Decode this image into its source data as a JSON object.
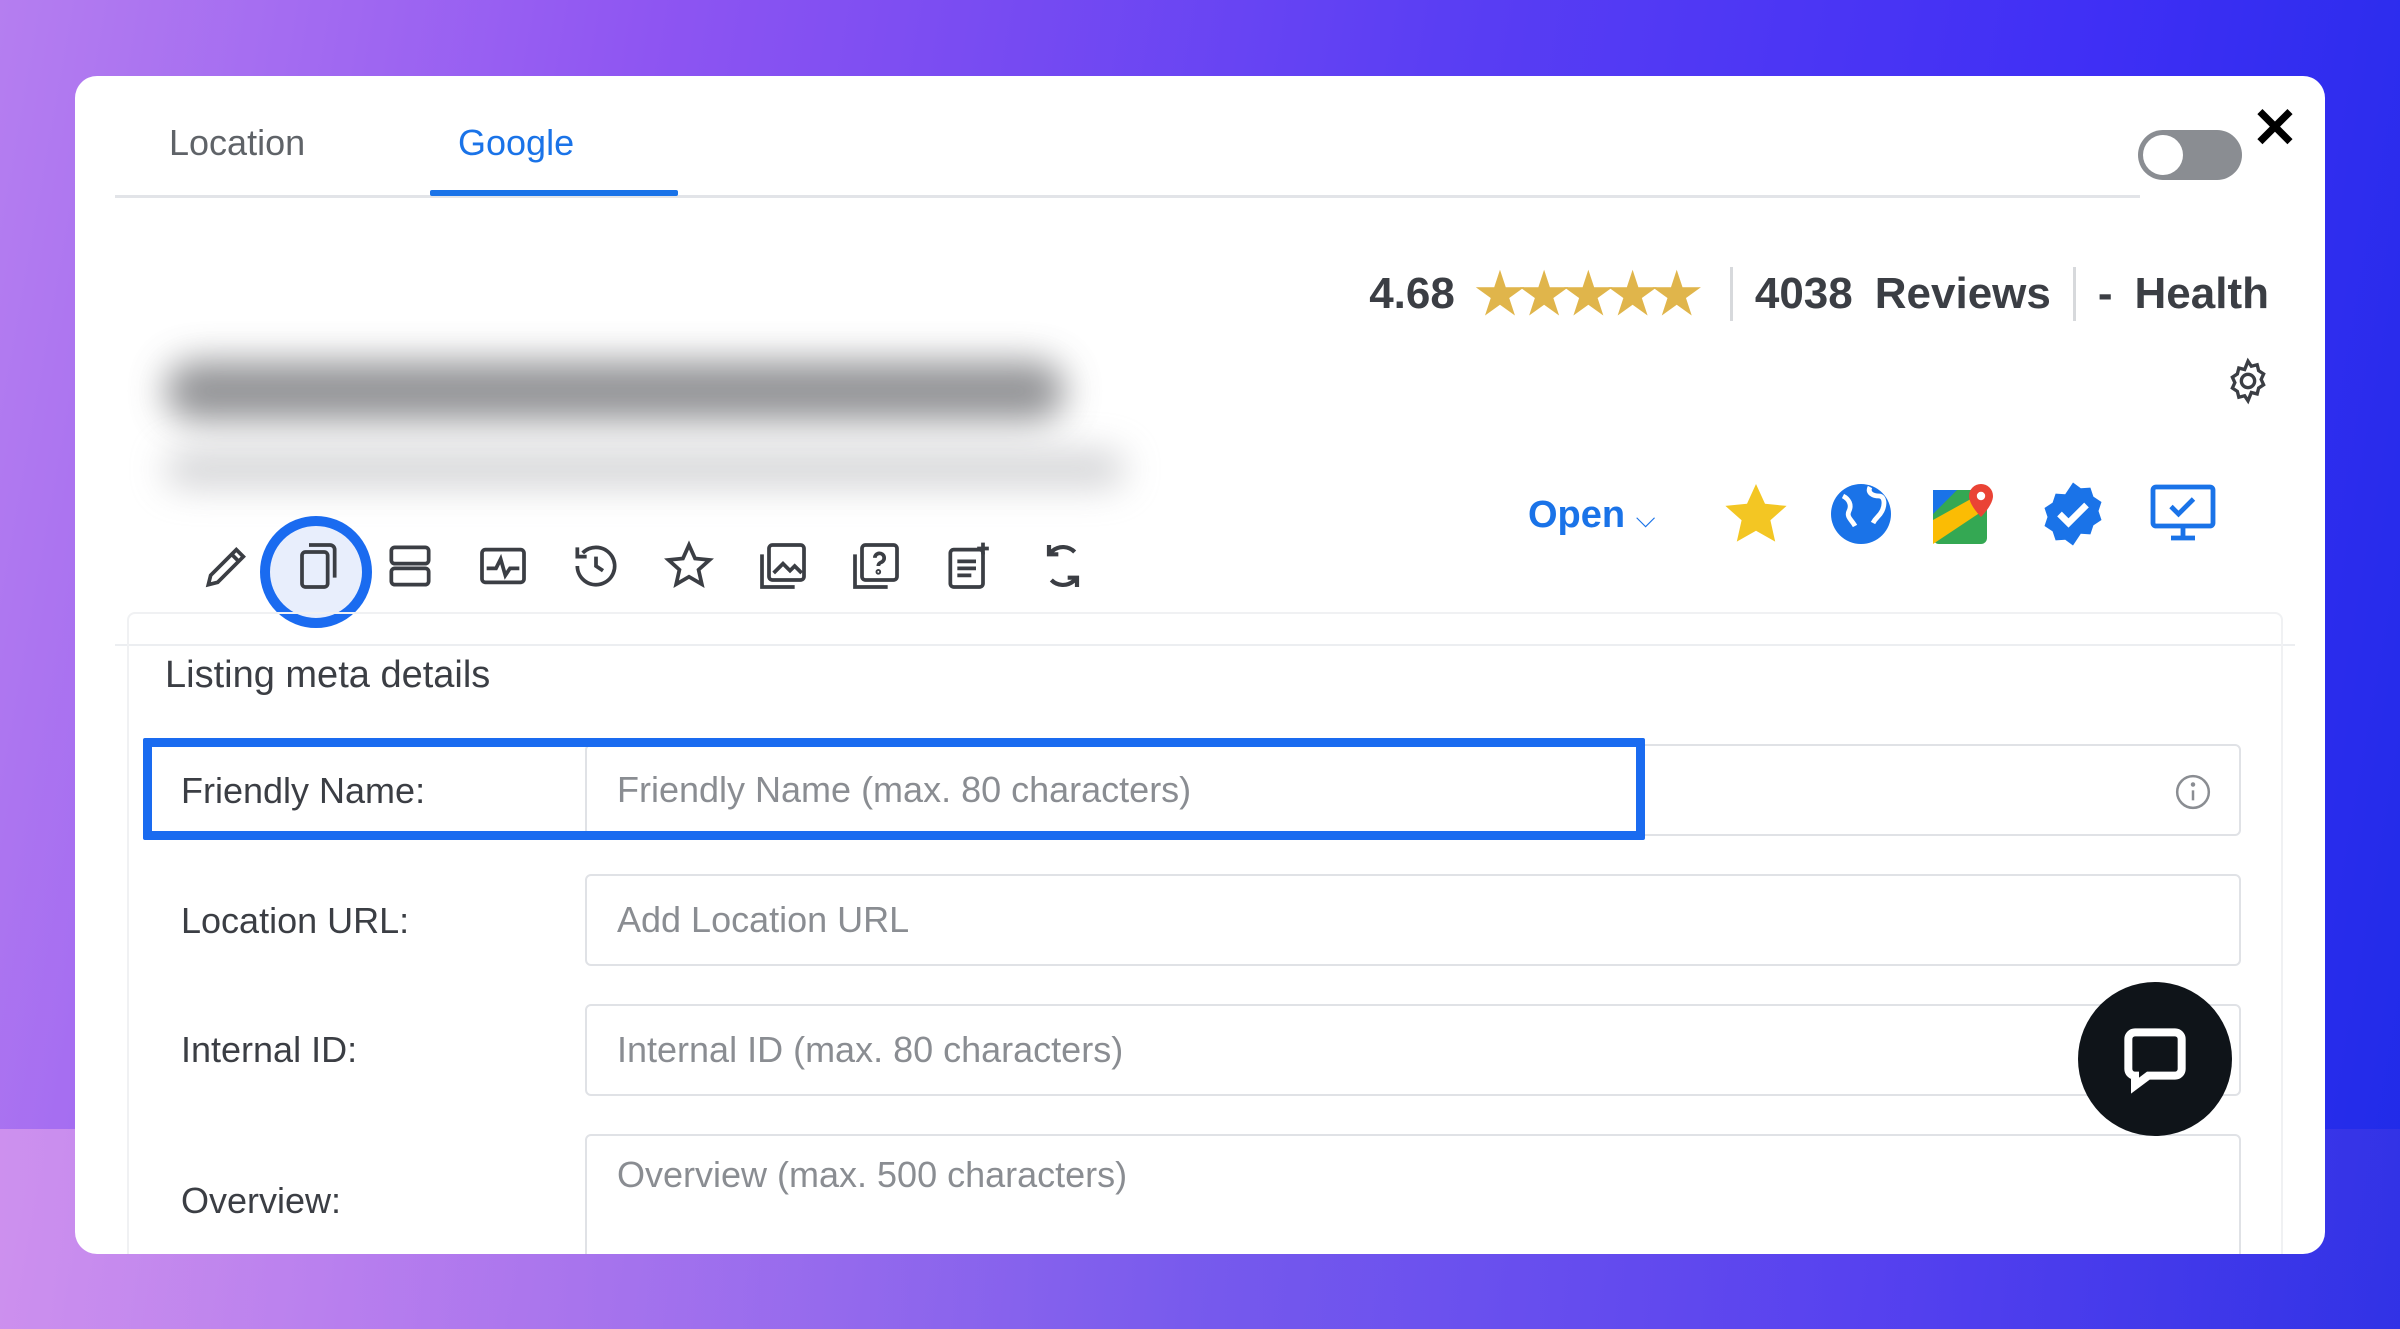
{
  "tabs": [
    {
      "label": "Location",
      "active": false
    },
    {
      "label": "Google",
      "active": true
    }
  ],
  "header": {
    "rating": "4.68",
    "stars_filled": 5,
    "reviews_count": "4038",
    "reviews_label": "Reviews",
    "health_prefix": "-",
    "health_label": "Health"
  },
  "toolbar": {
    "icons": [
      "pencil-icon",
      "copy-icon",
      "rows-icon",
      "activity-icon",
      "history-icon",
      "star-outline-icon",
      "image-icon",
      "question-icon",
      "post-icon",
      "sync-icon"
    ],
    "open_label": "Open",
    "external_icons": [
      "star-icon",
      "globe-icon",
      "google-maps-icon",
      "verified-badge-icon",
      "monitor-check-icon"
    ]
  },
  "card": {
    "title": "Listing meta details",
    "fields": [
      {
        "label": "Friendly Name:",
        "placeholder": "Friendly Name (max. 80 characters)"
      },
      {
        "label": "Location URL:",
        "placeholder": "Add Location URL"
      },
      {
        "label": "Internal ID:",
        "placeholder": "Internal ID (max. 80 characters)"
      },
      {
        "label": "Overview:",
        "placeholder": "Overview (max. 500 characters)"
      }
    ]
  },
  "colors": {
    "accent": "#1a73e8",
    "highlight": "#1a6bf0",
    "star": "#e0b54b"
  }
}
